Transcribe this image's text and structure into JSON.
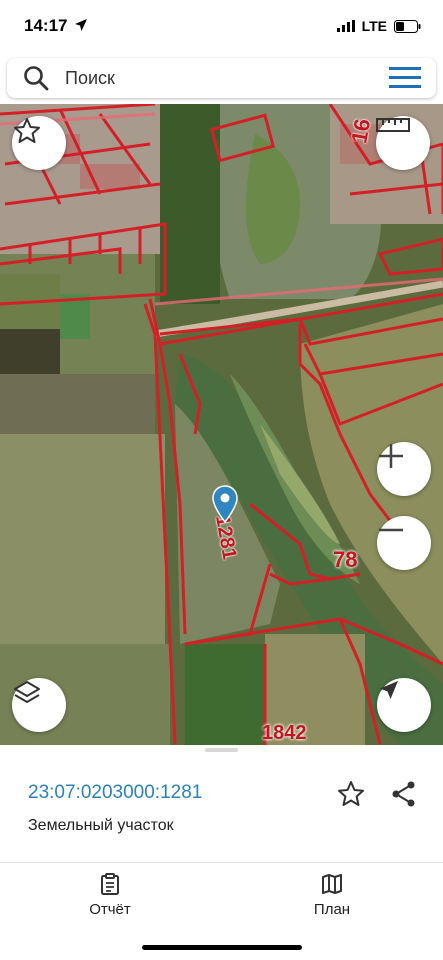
{
  "status_bar": {
    "time": "14:17",
    "network": "LTE"
  },
  "search": {
    "placeholder": "Поиск"
  },
  "map": {
    "parcel_labels": [
      "16",
      "1281",
      "78",
      "1842"
    ],
    "accent_color": "#d41f27",
    "marker_color": "#2f86c0"
  },
  "parcel": {
    "cadastral_number": "23:07:0203000:1281",
    "type": "Земельный участок"
  },
  "tabs": [
    {
      "label": "Отчёт",
      "icon": "report-icon"
    },
    {
      "label": "План",
      "icon": "map-plan-icon"
    }
  ]
}
